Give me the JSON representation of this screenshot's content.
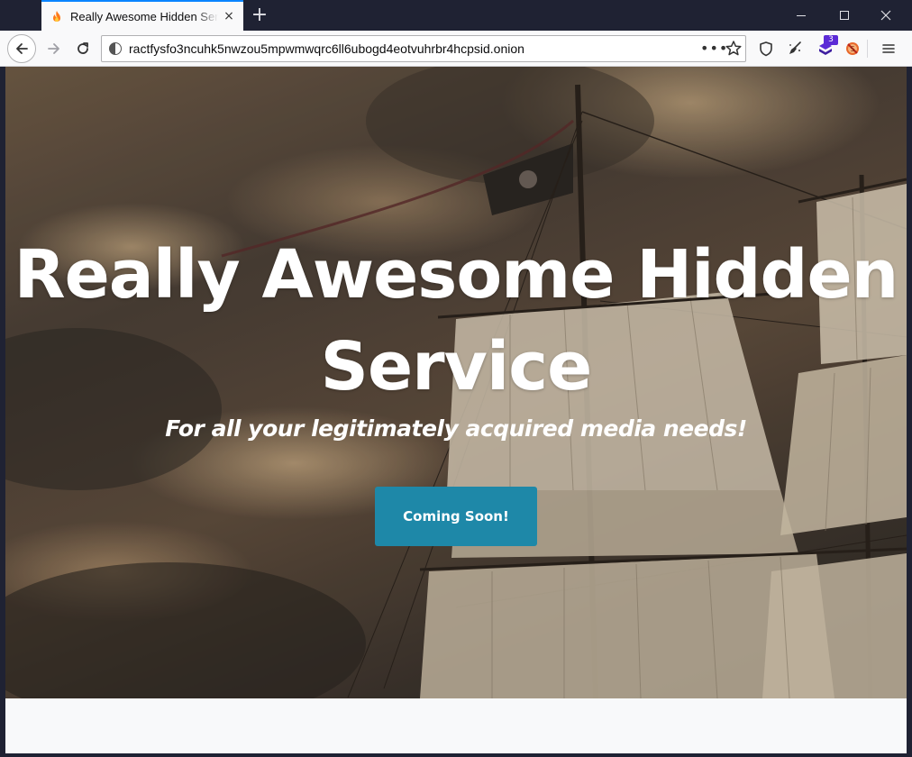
{
  "tab": {
    "title": "Really Awesome Hidden Service",
    "favicon": "fire-icon",
    "close_label": "×"
  },
  "toolbar": {
    "new_tab_label": "+",
    "url": "ractfysfo3ncuhk5nwzou5mpwmwqrc6ll6ubogd4eotvuhrbr4hcpsid.onion",
    "page_actions_label": "•••",
    "extension_badge": "3"
  },
  "page": {
    "title": "Really Awesome Hidden Service",
    "subtitle": "For all your legitimately acquired media needs!",
    "button_label": "Coming Soon!"
  },
  "colors": {
    "accent": "#1e88a8",
    "chrome": "#1f2233",
    "tab_highlight": "#0a84ff"
  }
}
